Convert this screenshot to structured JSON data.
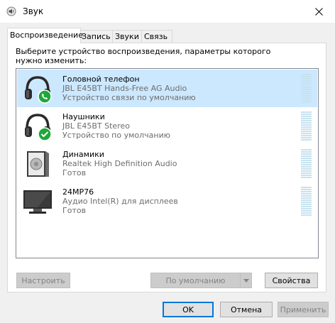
{
  "window": {
    "title": "Звук",
    "icon": "speaker-icon",
    "close_icon": "close-icon"
  },
  "tabs": [
    {
      "label": "Воспроизведение",
      "active": true
    },
    {
      "label": "Запись",
      "active": false
    },
    {
      "label": "Звуки",
      "active": false
    },
    {
      "label": "Связь",
      "active": false
    }
  ],
  "instruction": "Выберите устройство воспроизведения, параметры которого нужно изменить:",
  "devices": [
    {
      "name": "Головной телефон",
      "description": "JBL E45BT Hands-Free AG Audio",
      "status": "Устройство связи по умолчанию",
      "icon": "headset-phone-icon",
      "selected": true
    },
    {
      "name": "Наушники",
      "description": "JBL E45BT Stereo",
      "status": "Устройство по умолчанию",
      "icon": "headphones-check-icon",
      "selected": false
    },
    {
      "name": "Динамики",
      "description": "Realtek High Definition Audio",
      "status": "Готов",
      "icon": "speaker-box-icon",
      "selected": false
    },
    {
      "name": "24MP76",
      "description": "Аудио Intel(R) для дисплеев",
      "status": "Готов",
      "icon": "monitor-icon",
      "selected": false
    }
  ],
  "buttons": {
    "configure": "Настроить",
    "set_default": "По умолчанию",
    "properties": "Свойства",
    "ok": "OK",
    "cancel": "Отмена",
    "apply": "Применить"
  },
  "colors": {
    "selection": "#cce8ff",
    "accent": "#0078d7",
    "check_green": "#1fa83a"
  }
}
